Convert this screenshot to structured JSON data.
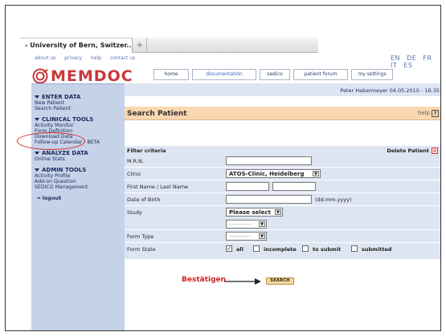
{
  "browser": {
    "tab_title": "- University of Bern, Switzer...",
    "new_tab_label": "+"
  },
  "header": {
    "util_links": [
      "about us",
      "privacy",
      "help",
      "contact us"
    ],
    "languages": [
      "EN",
      "DE",
      "FR",
      "IT",
      "ES"
    ],
    "logo_text": "MEMDOC",
    "nav": [
      {
        "label": "home"
      },
      {
        "label": "documentation"
      },
      {
        "label": "sedico"
      },
      {
        "label": "patient forum"
      },
      {
        "label": "my settings"
      }
    ],
    "active_nav": "documentation"
  },
  "sidebar": {
    "enter_data": {
      "title": "ENTER DATA",
      "items": [
        "New Patient",
        "Search Patient"
      ]
    },
    "clinical_tools": {
      "title": "CLINICAL TOOLS",
      "items": [
        "Activity Monitor",
        "Form Definition",
        "Download Data",
        "Follow-up Calendar - BETA"
      ]
    },
    "analyze_data": {
      "title": "ANALYZE DATA",
      "items": [
        "Online Stats"
      ]
    },
    "admin_tools": {
      "title": "ADMIN TOOLS",
      "items": [
        "Activity Profile",
        "Add-on Question",
        "SEDICO Management"
      ]
    },
    "logout": "logout",
    "logout_arrow": "→"
  },
  "userbar": {
    "text": "Peter Habermeyer   04.05.2010 - 16.35"
  },
  "search_panel": {
    "title": "Search Patient",
    "help_label": "help",
    "help_icon_text": "?"
  },
  "filter": {
    "label": "Filter criteria",
    "delete_label": "Delete Patient",
    "delete_icon_text": "×"
  },
  "form": {
    "mrn_label": "M.R.N.",
    "clinic_label": "Clinic",
    "clinic_value": "ATOS-Clinic, Heidelberg",
    "name_label": "First Name / Last Name",
    "dob_label": "Date of Birth",
    "dob_hint": "(dd.mm.yyyy)",
    "study_label": "Study",
    "study_value": "Please select",
    "study_sub_value": "---------",
    "form_type_label": "Form Type",
    "form_type_value": "---------",
    "form_state_label": "Form State",
    "select_arrow": "▼",
    "check_mark": "✓",
    "states": [
      {
        "label": "all",
        "checked": true
      },
      {
        "label": "incomplete",
        "checked": false
      },
      {
        "label": "to submit",
        "checked": false
      },
      {
        "label": "submitted",
        "checked": false
      }
    ]
  },
  "annotation": {
    "text": "Bestätigen",
    "accent_color": "#d42020"
  },
  "search_button": {
    "label": "SEARCH"
  }
}
